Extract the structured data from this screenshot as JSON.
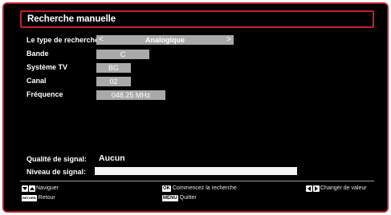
{
  "title": "Recherche manuelle",
  "fields": {
    "search_type": {
      "label": "Le type de recherche",
      "value": "Analogique"
    },
    "band": {
      "label": "Bande",
      "value": "C"
    },
    "tv_system": {
      "label": "Système TV",
      "value": "BG"
    },
    "channel": {
      "label": "Canal",
      "value": "02"
    },
    "frequency": {
      "label": "Fréquence",
      "value": "048.25 MHz"
    }
  },
  "signal": {
    "quality_label": "Qualité de signal:",
    "quality_value": "Aucun",
    "level_label": "Niveau de signal:",
    "level_fraction": 0
  },
  "help": {
    "navigate": "Naviguer",
    "return_key": "RETURN",
    "return": "Retour",
    "ok_key": "OK",
    "start": "Commencez la recherche",
    "menu_key": "MENU",
    "quit": "Quitter",
    "change": "Changer de valeur"
  },
  "colors": {
    "frame_border": "#b81e2c",
    "background": "#000000",
    "field_bg": "#a9a9a9"
  }
}
